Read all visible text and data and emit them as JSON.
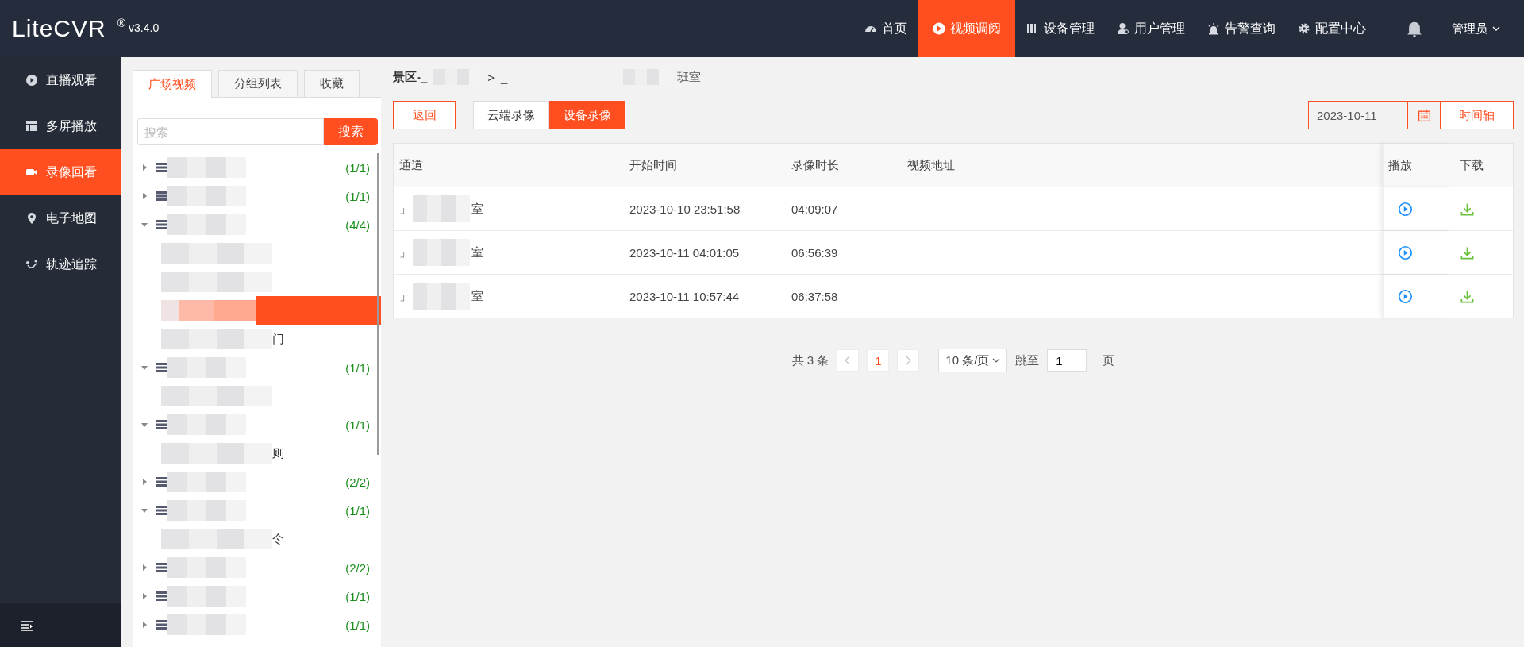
{
  "header": {
    "logo": "LiteCVR",
    "registered": "®",
    "version": "v3.4.0",
    "user": "管理员",
    "nav": [
      {
        "label": "首页",
        "selected": false
      },
      {
        "label": "视频调阅",
        "selected": true
      },
      {
        "label": "设备管理",
        "selected": false
      },
      {
        "label": "用户管理",
        "selected": false
      },
      {
        "label": "告警查询",
        "selected": false
      },
      {
        "label": "配置中心",
        "selected": false
      }
    ]
  },
  "sidebar": {
    "items": [
      {
        "label": "直播观看",
        "selected": false
      },
      {
        "label": "多屏播放",
        "selected": false
      },
      {
        "label": "录像回看",
        "selected": true
      },
      {
        "label": "电子地图",
        "selected": false
      },
      {
        "label": "轨迹追踪",
        "selected": false
      }
    ]
  },
  "tree_panel": {
    "tabs": [
      {
        "label": "广场视频",
        "selected": true
      },
      {
        "label": "分组列表",
        "selected": false
      },
      {
        "label": "收藏",
        "selected": false
      }
    ],
    "search": {
      "placeholder": "搜索",
      "button": "搜索"
    },
    "nodes": [
      {
        "expanded": false,
        "count": "(1/1)"
      },
      {
        "expanded": false,
        "count": "(1/1)"
      },
      {
        "expanded": true,
        "count": "(4/4)",
        "children": [
          {
            "selected": false
          },
          {
            "selected": false
          },
          {
            "selected": true
          },
          {
            "selected": false,
            "text": "门"
          }
        ]
      },
      {
        "expanded": true,
        "count": "(1/1)",
        "children": [
          {
            "selected": false
          }
        ]
      },
      {
        "expanded": true,
        "count": "(1/1)",
        "children": [
          {
            "selected": false,
            "text": "则"
          }
        ]
      },
      {
        "expanded": false,
        "count": "(2/2)"
      },
      {
        "expanded": true,
        "count": "(1/1)",
        "children": [
          {
            "selected": false,
            "text": "仒"
          }
        ]
      },
      {
        "expanded": false,
        "count": "(2/2)"
      },
      {
        "expanded": false,
        "count": "(1/1)"
      },
      {
        "expanded": false,
        "count": "(1/1)"
      }
    ]
  },
  "breadcrumb": {
    "first": "景区-_",
    "separator": ">",
    "second_start": "_",
    "second_end": "班室"
  },
  "toolbar": {
    "back": "返回",
    "sources": [
      {
        "label": "云端录像",
        "selected": false
      },
      {
        "label": "设备录像",
        "selected": true
      }
    ],
    "date": "2023-10-11",
    "timeline": "时间轴"
  },
  "table": {
    "columns": [
      "通道",
      "开始时间",
      "录像时长",
      "视频地址",
      "播放",
      "下载"
    ],
    "rows": [
      {
        "channel_start": "」",
        "channel_end": "室",
        "start": "2023-10-10 23:51:58",
        "duration": "04:09:07"
      },
      {
        "channel_start": "」",
        "channel_end": "室",
        "start": "2023-10-11 04:01:05",
        "duration": "06:56:39"
      },
      {
        "channel_start": "」",
        "channel_end": "室",
        "start": "2023-10-11 10:57:44",
        "duration": "06:37:58"
      }
    ]
  },
  "pagination": {
    "total": "共 3 条",
    "pages": [
      {
        "label": "1",
        "selected": true
      }
    ],
    "page_size": "10 条/页",
    "jump_label": "跳至",
    "jump_value": "1",
    "page_unit": "页"
  }
}
